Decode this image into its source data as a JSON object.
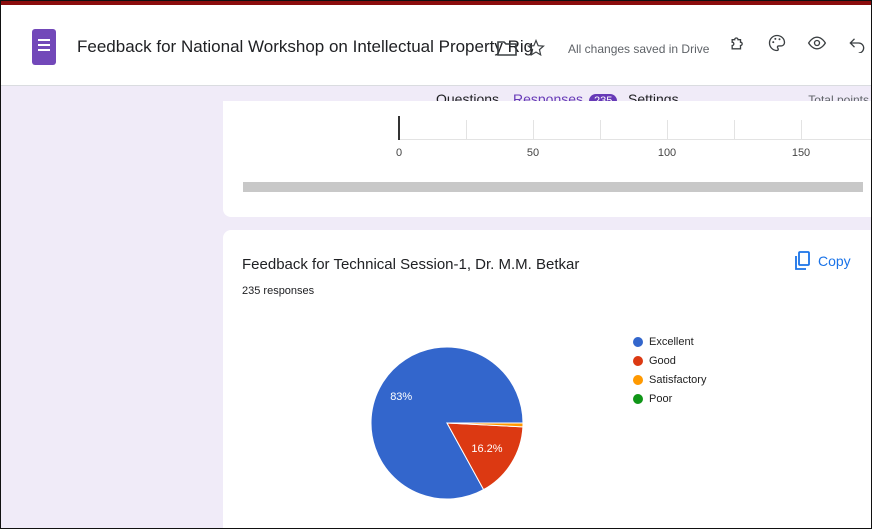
{
  "header": {
    "title": "Feedback  for National Workshop on Intellectual Property Rig",
    "saved_status": "All changes saved in Drive"
  },
  "tabs": [
    {
      "label": "Questions"
    },
    {
      "label": "Responses",
      "count": "235",
      "active": true
    },
    {
      "label": "Settings"
    }
  ],
  "total_points_label": "Total points",
  "previous_chart": {
    "ticks": [
      "0",
      "50",
      "100",
      "150"
    ]
  },
  "question": {
    "title": "Feedback for Technical Session-1, Dr. M.M. Betkar",
    "responses": "235 responses",
    "copy_label": "Copy"
  },
  "chart_data": {
    "type": "pie",
    "legend_position": "right",
    "slices": [
      {
        "label": "Excellent",
        "value": 83,
        "color": "#3366cc",
        "data_label": "83%"
      },
      {
        "label": "Good",
        "value": 16.2,
        "color": "#dc3912",
        "data_label": "16.2%"
      },
      {
        "label": "Satisfactory",
        "value": 0.8,
        "color": "#ff9900",
        "data_label": ""
      },
      {
        "label": "Poor",
        "value": 0,
        "color": "#109618",
        "data_label": ""
      }
    ]
  }
}
